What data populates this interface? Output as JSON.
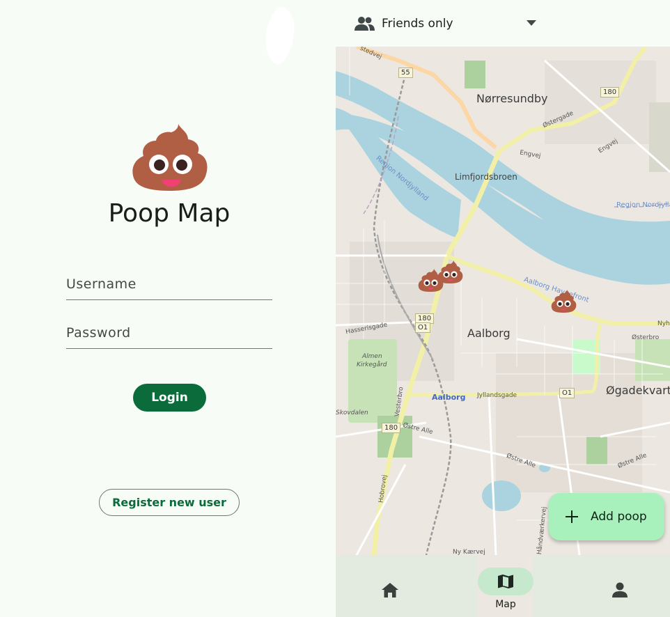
{
  "login": {
    "app_title": "Poop Map",
    "username_placeholder": "Username",
    "password_placeholder": "Password",
    "login_label": "Login",
    "register_label": "Register new user"
  },
  "map_screen": {
    "filter": {
      "selected": "Friends only",
      "icon": "people-icon"
    },
    "map_labels": {
      "norresundby": "Nørresundby",
      "limfjordsbroen": "Limfjordsbroen",
      "aalborg": "Aalborg",
      "aalborg_station": "Aalborg",
      "almen_kirkegard_1": "Almen",
      "almen_kirkegard_2": "Kirkegård",
      "ogadekvarter": "Øgadekvarter",
      "ostergade": "Østergade",
      "engvej": "Engvej",
      "engvej2": "Engvej",
      "region_nordjylland_1": "Region Nordjylland",
      "region_nordjylland_2": "Region Nordjylland",
      "aalborg_havnefront": "Aalborg Havnefront",
      "hasserisgade": "Hasserisgade",
      "vesterbro": "Vesterbro",
      "hobrovej": "Hobrovej",
      "ostre_alle_1": "Østre Alle",
      "ostre_alle_2": "Østre Alle",
      "ostre_alle_3": "Østre Alle",
      "jyllandsgade": "Jyllandsgade",
      "osterbro": "Østerbro",
      "skovdalen": "Skovdalen",
      "haandvaerkervej": "Håndværkervej",
      "ny_kaervej": "Ny Kærvej",
      "nyhavnsgade": "Nyh",
      "stedvej": "stedvej"
    },
    "shields": {
      "s55": "55",
      "s180_top": "180",
      "s180_center_a": "180",
      "s180_center_b": "O1",
      "s01_right": "O1",
      "s180_left": "180"
    },
    "fab_label": "Add poop",
    "nav": {
      "home": {
        "icon": "home-icon"
      },
      "map": {
        "icon": "map-icon",
        "label": "Map"
      },
      "profile": {
        "icon": "person-icon"
      }
    },
    "colors": {
      "primary": "#0b6b3a",
      "fab": "#a8f0bc",
      "nav_active_pill": "#c6e8cc",
      "water": "#aad3df"
    }
  }
}
